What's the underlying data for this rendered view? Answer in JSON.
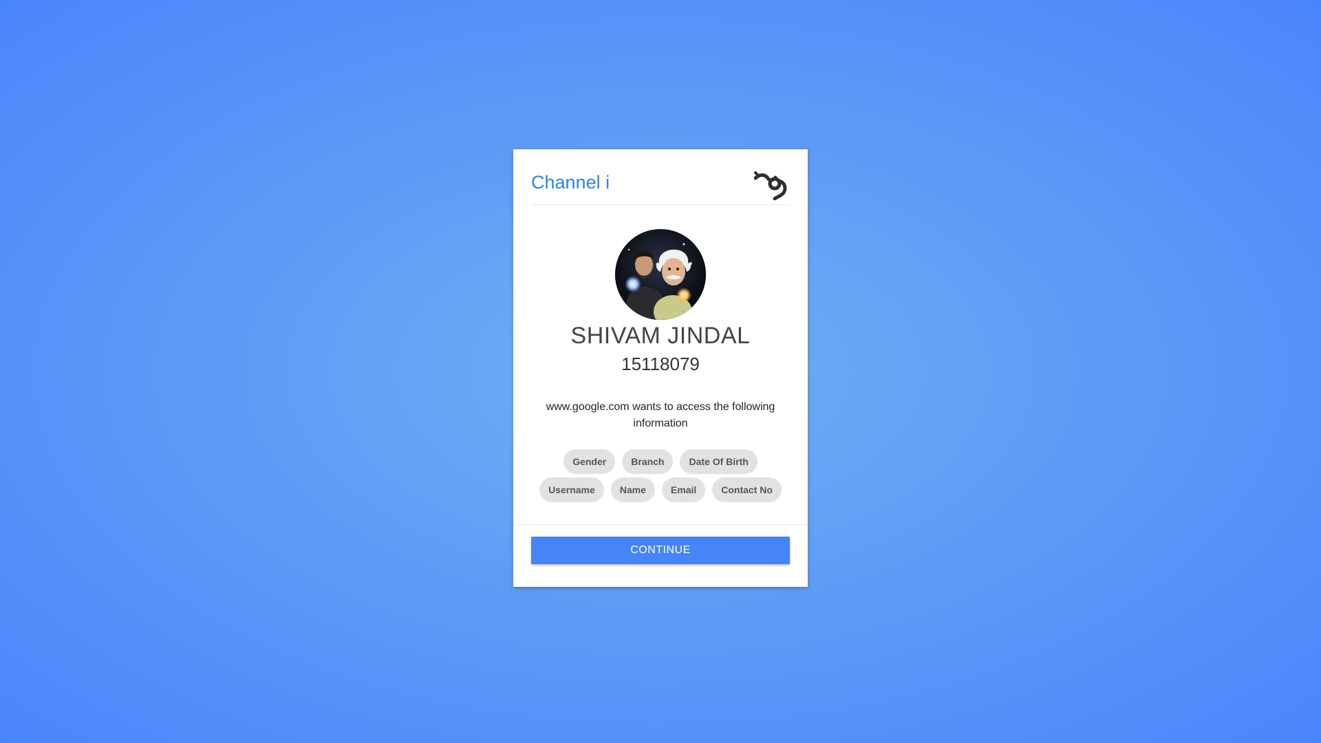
{
  "app": {
    "title": "Channel i",
    "logo_icon": "channel-i-logo-icon"
  },
  "user": {
    "name": "SHIVAM JINDAL",
    "id": "15118079",
    "avatar_icon": "user-avatar"
  },
  "request": {
    "message": "www.google.com wants to access the following information"
  },
  "permissions": {
    "row1": [
      "Gender",
      "Branch",
      "Date Of Birth"
    ],
    "row2": [
      "Username",
      "Name",
      "Email",
      "Contact No"
    ]
  },
  "actions": {
    "continue_label": "CONTINUE"
  },
  "colors": {
    "accent": "#4784f5",
    "title": "#2b86e0",
    "chip_bg": "#e2e2e2",
    "background_center": "#70b0f4",
    "background_edge": "#4a86fb"
  }
}
